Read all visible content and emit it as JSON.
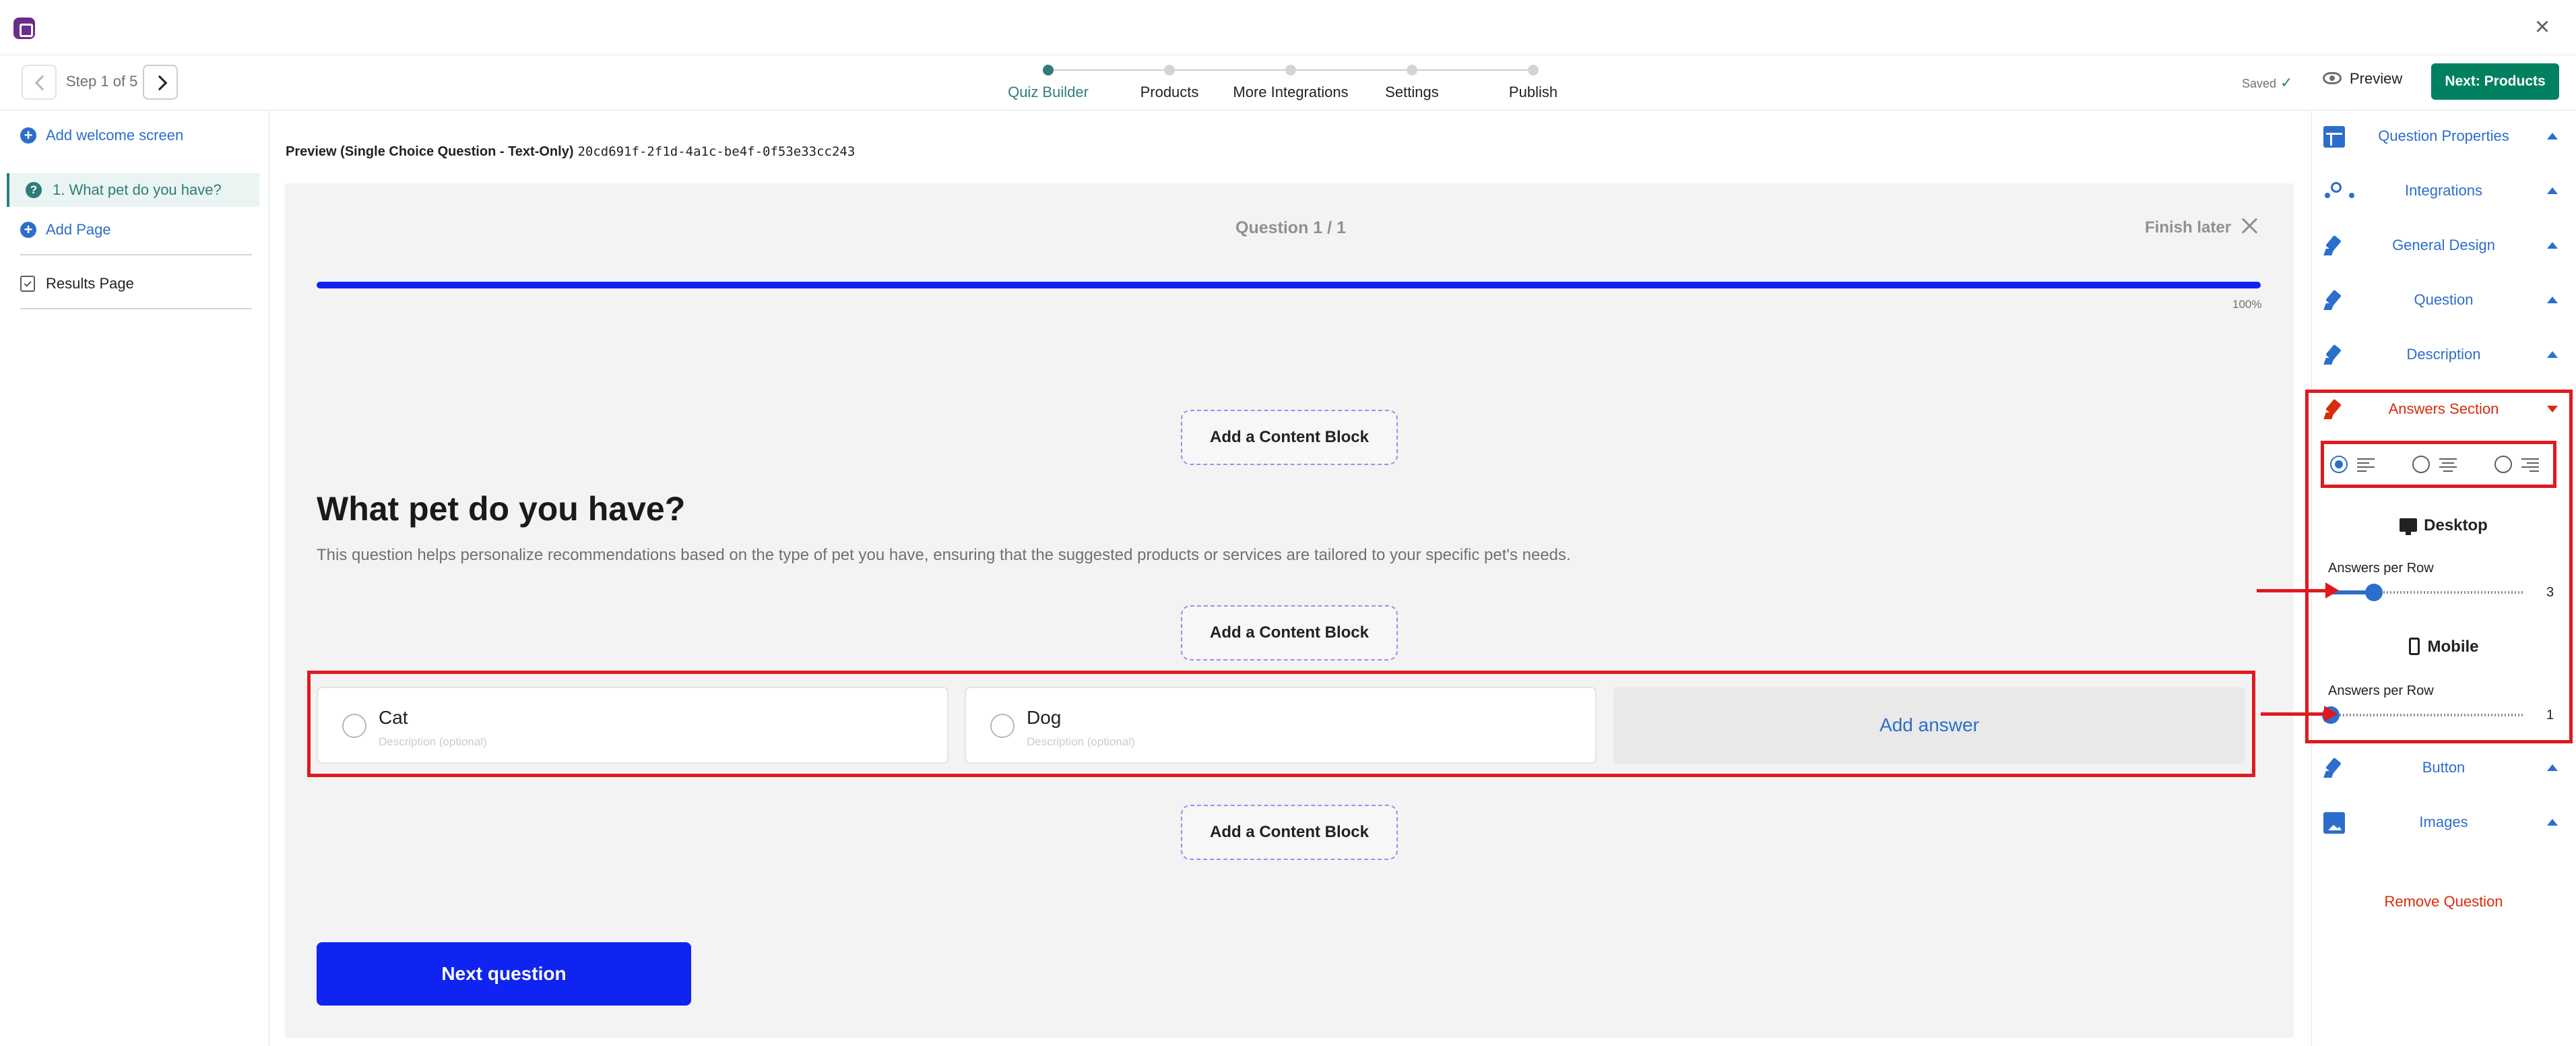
{
  "header": {
    "step_label": "Step 1 of 5",
    "steps": [
      {
        "label": "Quiz Builder",
        "active": true
      },
      {
        "label": "Products",
        "active": false
      },
      {
        "label": "More Integrations",
        "active": false
      },
      {
        "label": "Settings",
        "active": false
      },
      {
        "label": "Publish",
        "active": false
      }
    ],
    "saved_label": "Saved",
    "preview_label": "Preview",
    "next_label": "Next: Products",
    "accent_color": "#2f7d76",
    "primary_button_color": "#008060"
  },
  "left_sidebar": {
    "add_welcome": "Add welcome screen",
    "question_item": "1. What pet do you have?",
    "add_page": "Add Page",
    "results_page": "Results Page"
  },
  "main": {
    "preview_label": "Preview (Single Choice Question - Text-Only)",
    "preview_id": "20cd691f-2f1d-4a1c-be4f-0f53e33cc243",
    "question_counter": "Question 1 / 1",
    "finish_later": "Finish later",
    "progress_percent": 100,
    "progress_text": "100%",
    "content_block_label": "Add a Content Block",
    "question_title": "What pet do you have?",
    "question_description": "This question helps personalize recommendations based on the type of pet you have, ensuring that the suggested products or services are tailored to your specific pet's needs.",
    "answers": [
      {
        "label": "Cat",
        "description": "Description (optional)"
      },
      {
        "label": "Dog",
        "description": "Description (optional)"
      }
    ],
    "add_answer": "Add answer",
    "next_question": "Next question",
    "theme_color": "#0f24f0",
    "highlight_color": "#e0191e"
  },
  "right_sidebar": {
    "sections": {
      "question_properties": "Question Properties",
      "integrations": "Integrations",
      "general_design": "General Design",
      "question": "Question",
      "description": "Description",
      "answers_section": "Answers Section",
      "button": "Button",
      "images": "Images"
    },
    "alignment_selected": "left",
    "desktop_label": "Desktop",
    "mobile_label": "Mobile",
    "answers_per_row_label": "Answers per Row",
    "desktop_answers_per_row": 3,
    "desktop_answers_per_row_text": "3",
    "mobile_answers_per_row": 1,
    "mobile_answers_per_row_text": "1",
    "slider_max": 10,
    "remove_question": "Remove Question"
  }
}
